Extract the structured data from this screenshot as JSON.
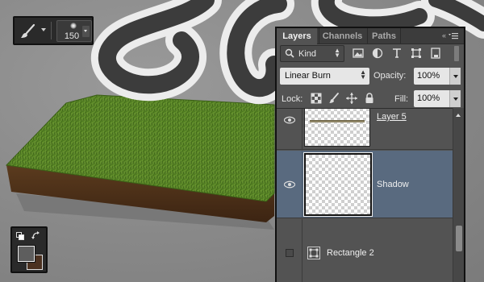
{
  "toolbar": {
    "tool": "brush-icon",
    "brush_size": "150"
  },
  "swatches": {
    "foreground": "#5e5e5e",
    "background": "#4b3120"
  },
  "panel": {
    "tabs": [
      {
        "label": "Layers",
        "active": true
      },
      {
        "label": "Channels",
        "active": false
      },
      {
        "label": "Paths",
        "active": false
      }
    ],
    "filter": {
      "kind_label": "Kind",
      "icons": [
        "image-filter-icon",
        "adjustment-filter-icon",
        "type-filter-icon",
        "shape-filter-icon",
        "smart-object-filter-icon"
      ]
    },
    "blend_mode": "Linear Burn",
    "opacity_label": "Opacity:",
    "opacity_value": "100%",
    "lock_label": "Lock:",
    "fill_label": "Fill:",
    "fill_value": "100%",
    "layers": [
      {
        "name": "Layer 5",
        "visible": true,
        "selected": false
      },
      {
        "name": "Shadow",
        "visible": true,
        "selected": true
      },
      {
        "name": "Rectangle 2",
        "visible": false,
        "selected": false
      }
    ],
    "colors": {
      "selected_row": "#596a7f",
      "panel_bg": "#535353"
    }
  }
}
